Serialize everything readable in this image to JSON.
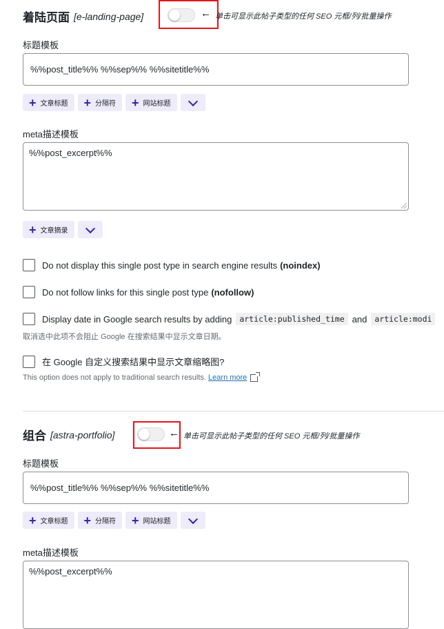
{
  "sections": [
    {
      "title": "着陆页面",
      "slug": "[e-landing-page]",
      "toggle_state": "off",
      "toggle_note": "单击可显示此帖子类型的任何 SEO 元框/列/批量操作",
      "title_template_label": "标题模板",
      "title_template_value": "%%post_title%% %%sep%% %%sitetitle%%",
      "title_buttons": [
        "文章标题",
        "分隔符",
        "网站标题"
      ],
      "meta_label": "meta描述模板",
      "meta_value": "%%post_excerpt%%",
      "meta_buttons": [
        "文章摘录"
      ],
      "checkboxes": [
        {
          "text": "Do not display this single post type in search engine results ",
          "bold": "(noindex)"
        },
        {
          "text": "Do not follow links for this single post type ",
          "bold": "(nofollow)"
        },
        {
          "text": "Display date in Google search results by adding",
          "code1": "article:published_time",
          "and": "and",
          "code2": "article:modi"
        },
        {
          "text": "在 Google 自定义搜索结果中显示文章缩略图?"
        }
      ],
      "date_help": "取消选中此项不会阻止 Google 在搜索结果中显示文章日期。",
      "thumb_help": "This option does not apply to traditional search results.",
      "learn_more": "Learn more"
    },
    {
      "title": "组合",
      "slug": "[astra-portfolio]",
      "toggle_state": "off",
      "toggle_note": "单击可显示此帖子类型的任何 SEO 元框/列/批量操作",
      "title_template_label": "标题模板",
      "title_template_value": "%%post_title%% %%sep%% %%sitetitle%%",
      "title_buttons": [
        "文章标题",
        "分隔符",
        "网站标题"
      ],
      "meta_label": "meta描述模板",
      "meta_value": "%%post_excerpt%%"
    }
  ],
  "icons": {
    "arrow": "←",
    "plus": "+",
    "chevron": "chevron-down-icon",
    "external": "external-link-icon"
  },
  "colors": {
    "accent": "#3a22a8",
    "button_bg": "#eeebfa",
    "highlight_box": "#e0161b",
    "link": "#2271b1"
  }
}
